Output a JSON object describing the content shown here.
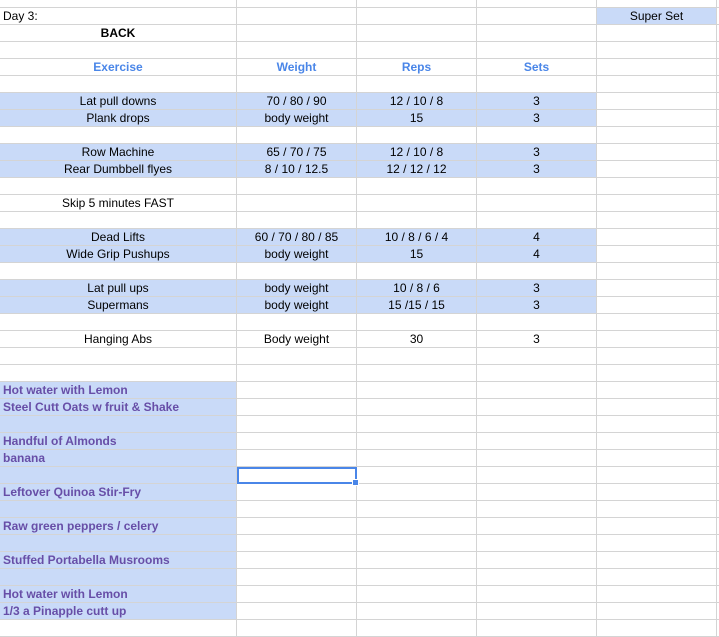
{
  "sheet": {
    "day_label": "Day 3:",
    "workout_title": "BACK",
    "superset_label": "Super Set",
    "columns": [
      "Exercise",
      "Weight",
      "Reps",
      "Sets"
    ],
    "exercises": [
      {
        "name": "Lat pull downs",
        "weight": "70 / 80 / 90",
        "reps": "12 / 10 / 8",
        "sets": "3"
      },
      {
        "name": "Plank drops",
        "weight": "body weight",
        "reps": "15",
        "sets": "3"
      },
      {
        "name": "Row Machine",
        "weight": "65 / 70 / 75",
        "reps": "12 / 10 / 8",
        "sets": "3"
      },
      {
        "name": "Rear Dumbbell flyes",
        "weight": "8 / 10 / 12.5",
        "reps": "12 / 12 / 12",
        "sets": "3"
      },
      {
        "name": "Skip 5 minutes FAST",
        "weight": "",
        "reps": "",
        "sets": ""
      },
      {
        "name": "Dead Lifts",
        "weight": "60 / 70 / 80 / 85",
        "reps": "10 / 8 / 6 / 4",
        "sets": "4"
      },
      {
        "name": "Wide Grip Pushups",
        "weight": "body weight",
        "reps": "15",
        "sets": "4"
      },
      {
        "name": "Lat pull ups",
        "weight": "body weight",
        "reps": "10 / 8 / 6",
        "sets": "3"
      },
      {
        "name": "Supermans",
        "weight": "body weight",
        "reps": "15 /15 / 15",
        "sets": "3"
      },
      {
        "name": "Hanging Abs",
        "weight": "Body weight",
        "reps": "30",
        "sets": "3"
      }
    ],
    "meals": [
      "Hot water with Lemon",
      "Steel Cutt Oats w fruit & Shake",
      "Handful of Almonds",
      "banana",
      "Leftover Quinoa Stir-Fry",
      "Raw green peppers / celery",
      "Stuffed Portabella Musrooms",
      "Hot water with Lemon",
      "1/3 a Pinapple cutt up"
    ]
  },
  "colors": {
    "header_text": "#4a86e8",
    "highlight_fill": "#c9daf8",
    "meal_text": "#674ea7",
    "selection": "#4a86e8",
    "gridline": "#d4d4d4"
  }
}
